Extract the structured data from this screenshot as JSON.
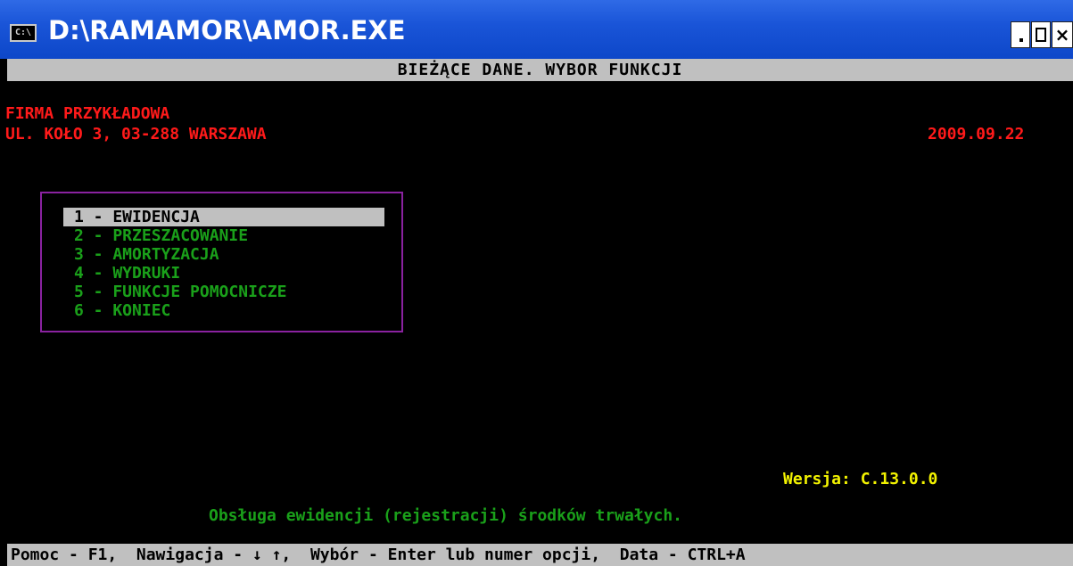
{
  "window": {
    "icon_text": "C:\\",
    "title": "D:\\RAMAMOR\\AMOR.EXE",
    "close_glyph": "×"
  },
  "header": {
    "title": "BIEŻĄCE DANE. WYBOR FUNKCJI"
  },
  "company": {
    "name": "FIRMA PRZYKŁADOWA",
    "address": "UL. KOŁO 3, 03-288 WARSZAWA",
    "date": "2009.09.22"
  },
  "menu": {
    "items": [
      {
        "label": "1 - EWIDENCJA",
        "selected": true
      },
      {
        "label": "2 - PRZESZACOWANIE",
        "selected": false
      },
      {
        "label": "3 - AMORTYZACJA",
        "selected": false
      },
      {
        "label": "4 - WYDRUKI",
        "selected": false
      },
      {
        "label": "5 - FUNKCJE POMOCNICZE",
        "selected": false
      },
      {
        "label": "6 - KONIEC",
        "selected": false
      }
    ]
  },
  "version": "Wersja: C.13.0.0",
  "description": "Obsługa ewidencji (rejestracji) środków trwałych.",
  "status_bar": "Pomoc - F1,  Nawigacja - ↓ ↑,  Wybór - Enter lub numer opcji,  Data - CTRL+A",
  "colors": {
    "titlebar": "#1a55d8",
    "console_bg": "#000000",
    "bar_bg": "#c0c0c0",
    "red": "#ff1a1a",
    "green": "#1aa01a",
    "yellow": "#f2f200",
    "menu_border": "#8a22a0"
  }
}
